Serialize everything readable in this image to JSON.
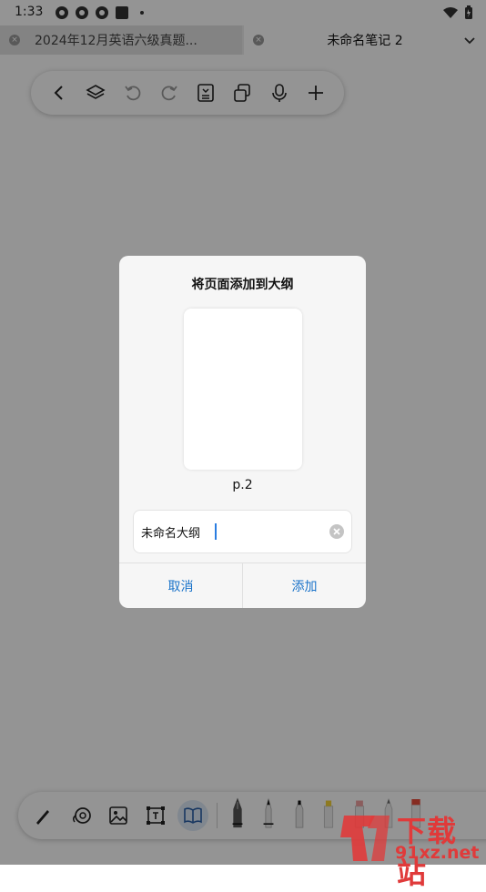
{
  "status_bar": {
    "time": "1:33"
  },
  "tabs": [
    {
      "label": "2024年12月英语六级真题...",
      "active": false
    },
    {
      "label": "未命名笔记 2",
      "active": true
    }
  ],
  "top_toolbar": {
    "icons": [
      "back-icon",
      "layers-icon",
      "undo-icon",
      "redo-icon",
      "page-list-icon",
      "copy-icon",
      "microphone-icon",
      "add-icon"
    ]
  },
  "dialog": {
    "title": "将页面添加到大纲",
    "page_label": "p.2",
    "name_field": {
      "value": "未命名大纲"
    },
    "cancel_label": "取消",
    "add_label": "添加"
  },
  "bottom_toolbar": {
    "icons": [
      "pen-icon",
      "lasso-icon",
      "image-icon",
      "text-box-icon",
      "book-icon"
    ],
    "selected": "book-icon",
    "pens": [
      "fountain-pen",
      "ballpoint-pen",
      "marker-pen",
      "highlighter-yellow",
      "highlighter-red",
      "pencil",
      "eraser"
    ]
  },
  "watermark": {
    "text": "下载站",
    "url": "91xz.net"
  },
  "colors": {
    "accent": "#1a73c9",
    "cursor": "#2a7de1",
    "watermark": "#e03a3a"
  }
}
